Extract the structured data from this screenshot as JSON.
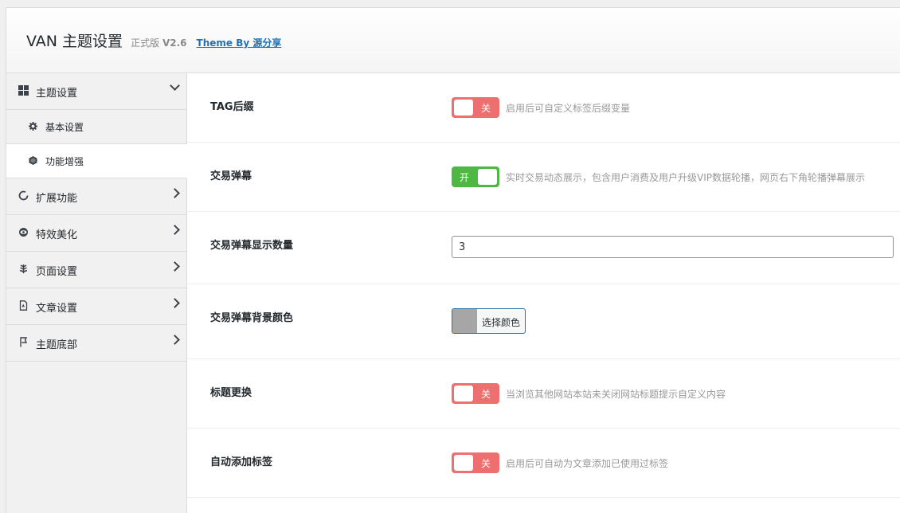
{
  "header": {
    "title": "VAN 主题设置",
    "edition": "正式版",
    "version": "V2.6",
    "link": "Theme By 源分享"
  },
  "sidebar": {
    "sections": [
      {
        "label": "主题设置",
        "icon": "grid-icon",
        "expanded": true
      },
      {
        "label": "扩展功能",
        "icon": "spinner-icon"
      },
      {
        "label": "特效美化",
        "icon": "eye-icon"
      },
      {
        "label": "页面设置",
        "icon": "leaf-icon"
      },
      {
        "label": "文章设置",
        "icon": "file-icon"
      },
      {
        "label": "主题底部",
        "icon": "flag-icon"
      }
    ],
    "subitems": [
      {
        "label": "基本设置",
        "icon": "gear-icon",
        "active": false
      },
      {
        "label": "功能增强",
        "icon": "cube-icon",
        "active": true
      }
    ]
  },
  "settings": [
    {
      "label": "TAG后缀",
      "type": "switch",
      "state": "关",
      "desc": "启用后可自定义标签后缀变量"
    },
    {
      "label": "交易弹幕",
      "type": "switch",
      "state": "开",
      "desc": "实时交易动态展示，包含用户消费及用户升级VIP数据轮播，网页右下角轮播弹幕展示"
    },
    {
      "label": "交易弹幕显示数量",
      "type": "number",
      "value": "3"
    },
    {
      "label": "交易弹幕背景颜色",
      "type": "color",
      "button": "选择颜色",
      "color": "#a6a6a6"
    },
    {
      "label": "标题更换",
      "type": "switch",
      "state": "关",
      "desc": "当浏览其他网站本站未关闭网站标题提示自定义内容"
    },
    {
      "label": "自动添加标签",
      "type": "switch",
      "state": "关",
      "desc": "启用后可自动为文章添加已使用过标签"
    }
  ],
  "colors": {
    "switch_off": "#ed6f6f",
    "switch_on": "#4fb845",
    "link": "#2271b1"
  }
}
